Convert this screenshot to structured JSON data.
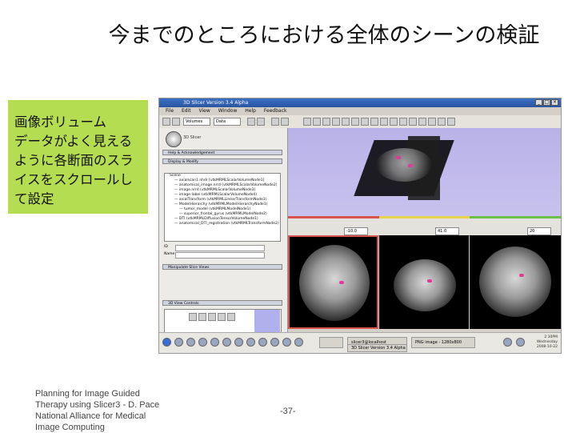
{
  "slide": {
    "title": "今までのところにおける全体のシーンの検証",
    "callout": "画像ボリューム\nデータがよく見える\nように各断面のスラ\nイスをスクロールし\nて設定",
    "footer_left": "Planning for Image Guided Therapy using Slicer3 - D. Pace National Alliance for Medical Image Computing",
    "page_number": "-37-"
  },
  "screenshot": {
    "window_title": "3D Slicer Version 3.4 Alpha",
    "menu": [
      "File",
      "Edit",
      "View",
      "Window",
      "Help",
      "Feedback"
    ],
    "toolbar_module": "Volumes",
    "toolbar_layout": "Data",
    "logo_label": "3D Slicer",
    "sections": {
      "help": "Help & Acknowledgement",
      "display": "Display & Modify",
      "manipulate": "Manipulate Slice Views",
      "slice_ctl": "3D View Controls"
    },
    "tree_rows": [
      "Scene",
      "— axialscan1.nhdr [vtkMRMLScalarVolumeNode1]",
      "— anatomical_image.nrrd (vtkMRMLScalarVolumeNode2)",
      "— image.nrrd (vtkMRMLScalarVolumeNode3)",
      "— image-label (vtkMRMLScalarVolumeNode4)",
      "— axialTransform (vtkMRMLLinearTransformNode1)",
      "— ModelHierarchy (vtkMRMLModelHierarchyNode1)",
      "— tumor_model (vtkMRMLModelNode1)",
      "— superior_frontal_gyrus (vtkMRMLModelNode2)",
      "— DTI (vtkMRMLDiffusionTensorVolumeNode1)",
      "— anatomical_DTI_registration (vtkMRMLTransformNode2)"
    ],
    "props": {
      "id_label": "ID",
      "name_label": "Name"
    },
    "slice_values": [
      "-10.0",
      "41.0",
      "20"
    ],
    "taskbar": {
      "start": "Start",
      "tasks": [
        "slicer3@localhost",
        "3D Slicer Version 3.4 Alpha",
        "PNG image - 1280x800"
      ],
      "clock": "2:30PM\nWednesday\n2008-10-22"
    },
    "colors": {
      "red_slice": "#d9534f",
      "yellow_slice": "#e8d44d",
      "green_slice": "#6cc04a",
      "view_bg": "#b9b2e8",
      "callout": "#b5dd52"
    }
  }
}
